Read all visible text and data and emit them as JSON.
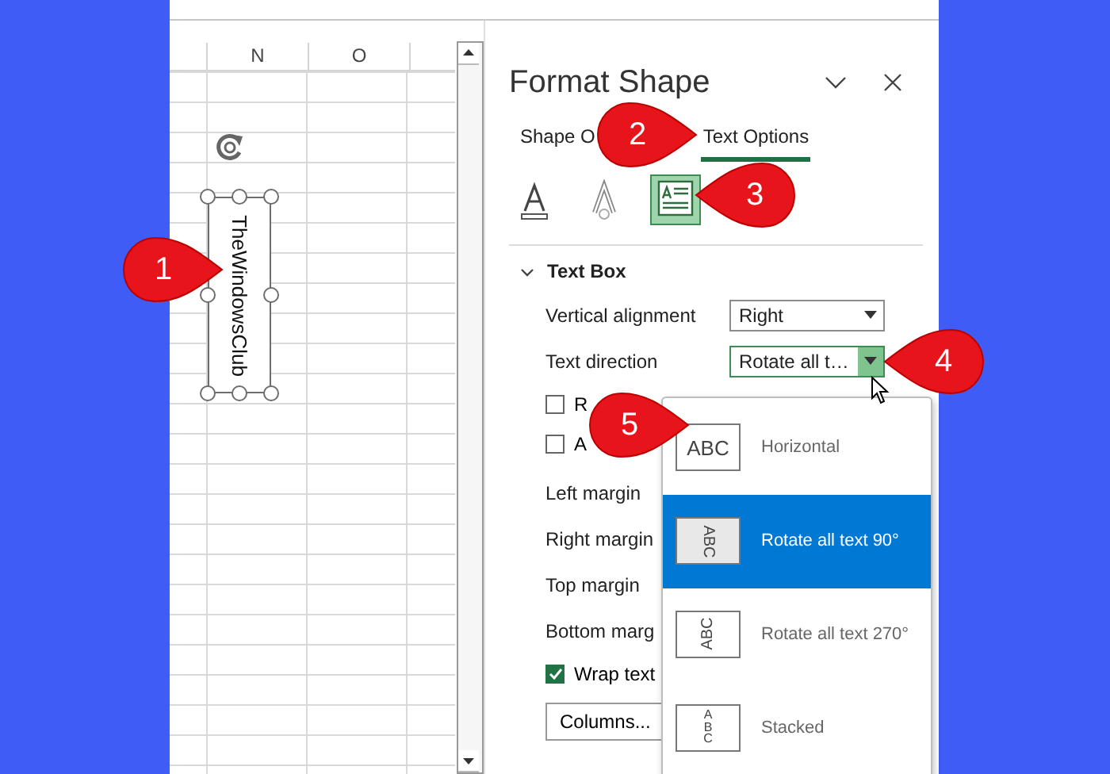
{
  "sheet": {
    "columns": [
      {
        "label": "N"
      },
      {
        "label": "O"
      }
    ],
    "text_box": {
      "text": "TheWindowsClub",
      "selected": true
    }
  },
  "pane": {
    "title": "Format Shape",
    "tabs": [
      {
        "label": "Shape O",
        "selected": false
      },
      {
        "label": "Text Options",
        "selected": true
      }
    ],
    "icon_tabs": [
      {
        "kind": "text-fill",
        "selected": false
      },
      {
        "kind": "text-effects",
        "selected": false
      },
      {
        "kind": "textbox",
        "selected": true
      }
    ],
    "section": {
      "title": "Text Box",
      "expanded": true
    },
    "fields": [
      {
        "label": "Vertical alignment",
        "value": "Right",
        "open": false
      },
      {
        "label": "Text direction",
        "value": "Rotate all t…",
        "open": true
      }
    ],
    "checkboxes": [
      {
        "label": "R",
        "checked": false
      },
      {
        "label": "A",
        "checked": false
      }
    ],
    "margins": [
      "Left margin",
      "Right margin",
      "Top margin",
      "Bottom marg"
    ],
    "wrap": {
      "label": "Wrap text",
      "checked": true
    },
    "button": "Columns..."
  },
  "dropdown": {
    "options": [
      {
        "kind": "horizontal",
        "preview": "ABC",
        "label": "Horizontal",
        "selected": false
      },
      {
        "kind": "rotate90",
        "preview": "ABC",
        "label": "Rotate all text 90°",
        "selected": true
      },
      {
        "kind": "rotate270",
        "preview": "ABC",
        "label": "Rotate all text 270°",
        "selected": false
      },
      {
        "kind": "stacked",
        "preview": "ABC",
        "label": "Stacked",
        "selected": false
      }
    ]
  },
  "callouts": [
    {
      "label": "1"
    },
    {
      "label": "2"
    },
    {
      "label": "3"
    },
    {
      "label": "4"
    },
    {
      "label": "5"
    }
  ]
}
